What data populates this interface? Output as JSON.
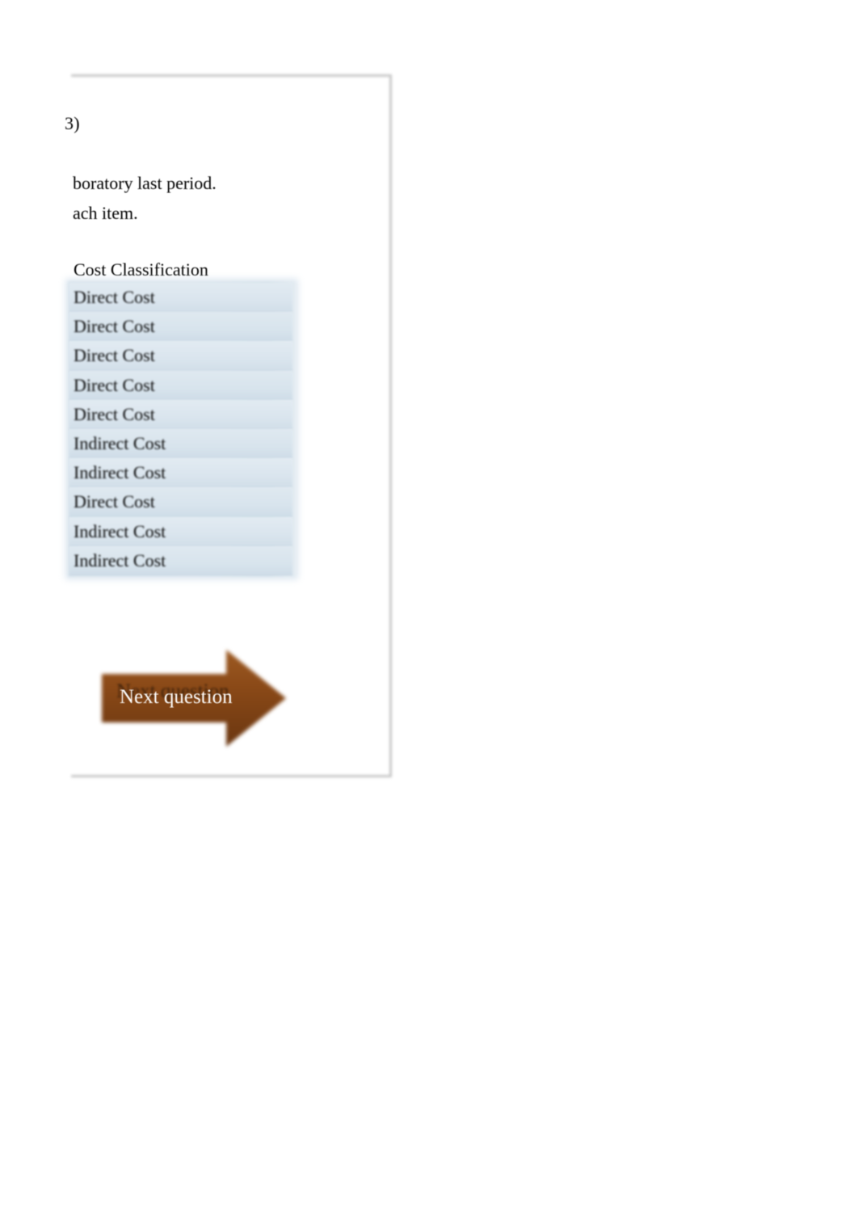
{
  "slide": {
    "question_number": "3)",
    "body_lines": [
      "boratory last period.",
      "ach item."
    ],
    "table": {
      "column_header": "Cost Classification",
      "rows": [
        "Direct Cost",
        "Direct Cost",
        "Direct Cost",
        "Direct Cost",
        "Direct Cost",
        "Indirect Cost",
        "Indirect Cost",
        "Direct Cost",
        "Indirect Cost",
        "Indirect Cost"
      ]
    },
    "next_button": {
      "label": "Next question",
      "shadow_label": "Next question",
      "arrow_direction": "right",
      "fill_color": "#8b4a17",
      "text_color": "#ffffff"
    },
    "colors": {
      "frame_border": "#c7c7c7",
      "row_background": "#dce7ef",
      "row_divider": "#c6d6e2",
      "page_background": "#ffffff",
      "text": "#000000"
    }
  }
}
